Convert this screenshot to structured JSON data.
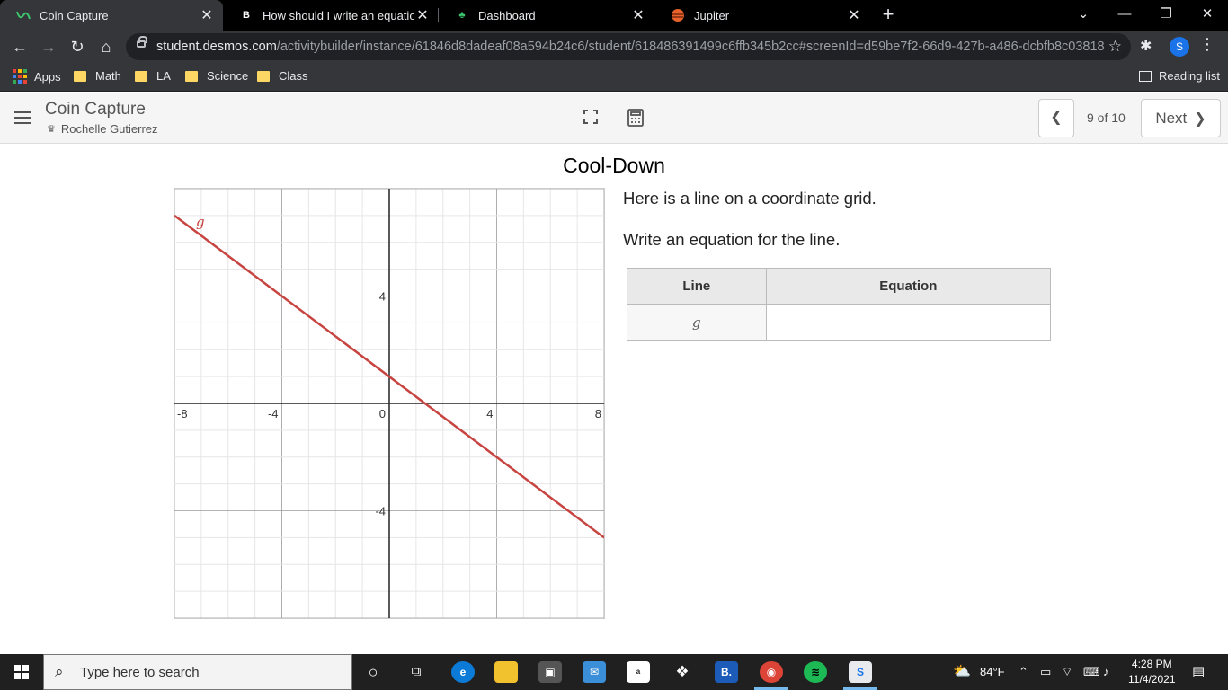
{
  "browser": {
    "tabs": [
      {
        "label": "Coin Capture",
        "icon": "desmos-favicon",
        "active": true
      },
      {
        "label": "How should I write an equation fo",
        "icon": "brainly-favicon"
      },
      {
        "label": "Dashboard",
        "icon": "dashboard-favicon"
      },
      {
        "label": "Jupiter",
        "icon": "jupiter-favicon"
      }
    ],
    "url_host": "student.desmos.com",
    "url_path": "/activitybuilder/instance/61846d8dadeaf08a594b24c6/student/618486391499c6ffb345b2cc#screenId=d59be7f2-66d9-427b-a486-dcbfb8c03818",
    "profile_initial": "S",
    "bookmarks": [
      "Apps",
      "Math",
      "LA",
      "Science",
      "Class"
    ],
    "reading_list": "Reading list"
  },
  "activity": {
    "title": "Coin Capture",
    "teacher": "Rochelle Gutierrez",
    "page_count": "9 of 10",
    "next_label": "Next"
  },
  "screen": {
    "title": "Cool-Down",
    "prompt_1": "Here is a line on a coordinate grid.",
    "prompt_2": "Write an equation for the line.",
    "table": {
      "headers": [
        "Line",
        "Equation"
      ],
      "rows": [
        [
          "g",
          ""
        ]
      ]
    }
  },
  "chart_data": {
    "type": "line",
    "xlim": [
      -8,
      8
    ],
    "ylim": [
      -8,
      8
    ],
    "grid": true,
    "x_ticks": [
      "-8",
      "-4",
      "0",
      "4",
      "8"
    ],
    "y_ticks": [
      "4",
      "-4"
    ],
    "series": [
      {
        "name": "g",
        "color": "#c74440",
        "x": [
          -8,
          8
        ],
        "y": [
          7,
          -5
        ]
      }
    ]
  },
  "taskbar": {
    "search_placeholder": "Type here to search",
    "weather": "84°F",
    "time": "4:28 PM",
    "date": "11/4/2021"
  }
}
